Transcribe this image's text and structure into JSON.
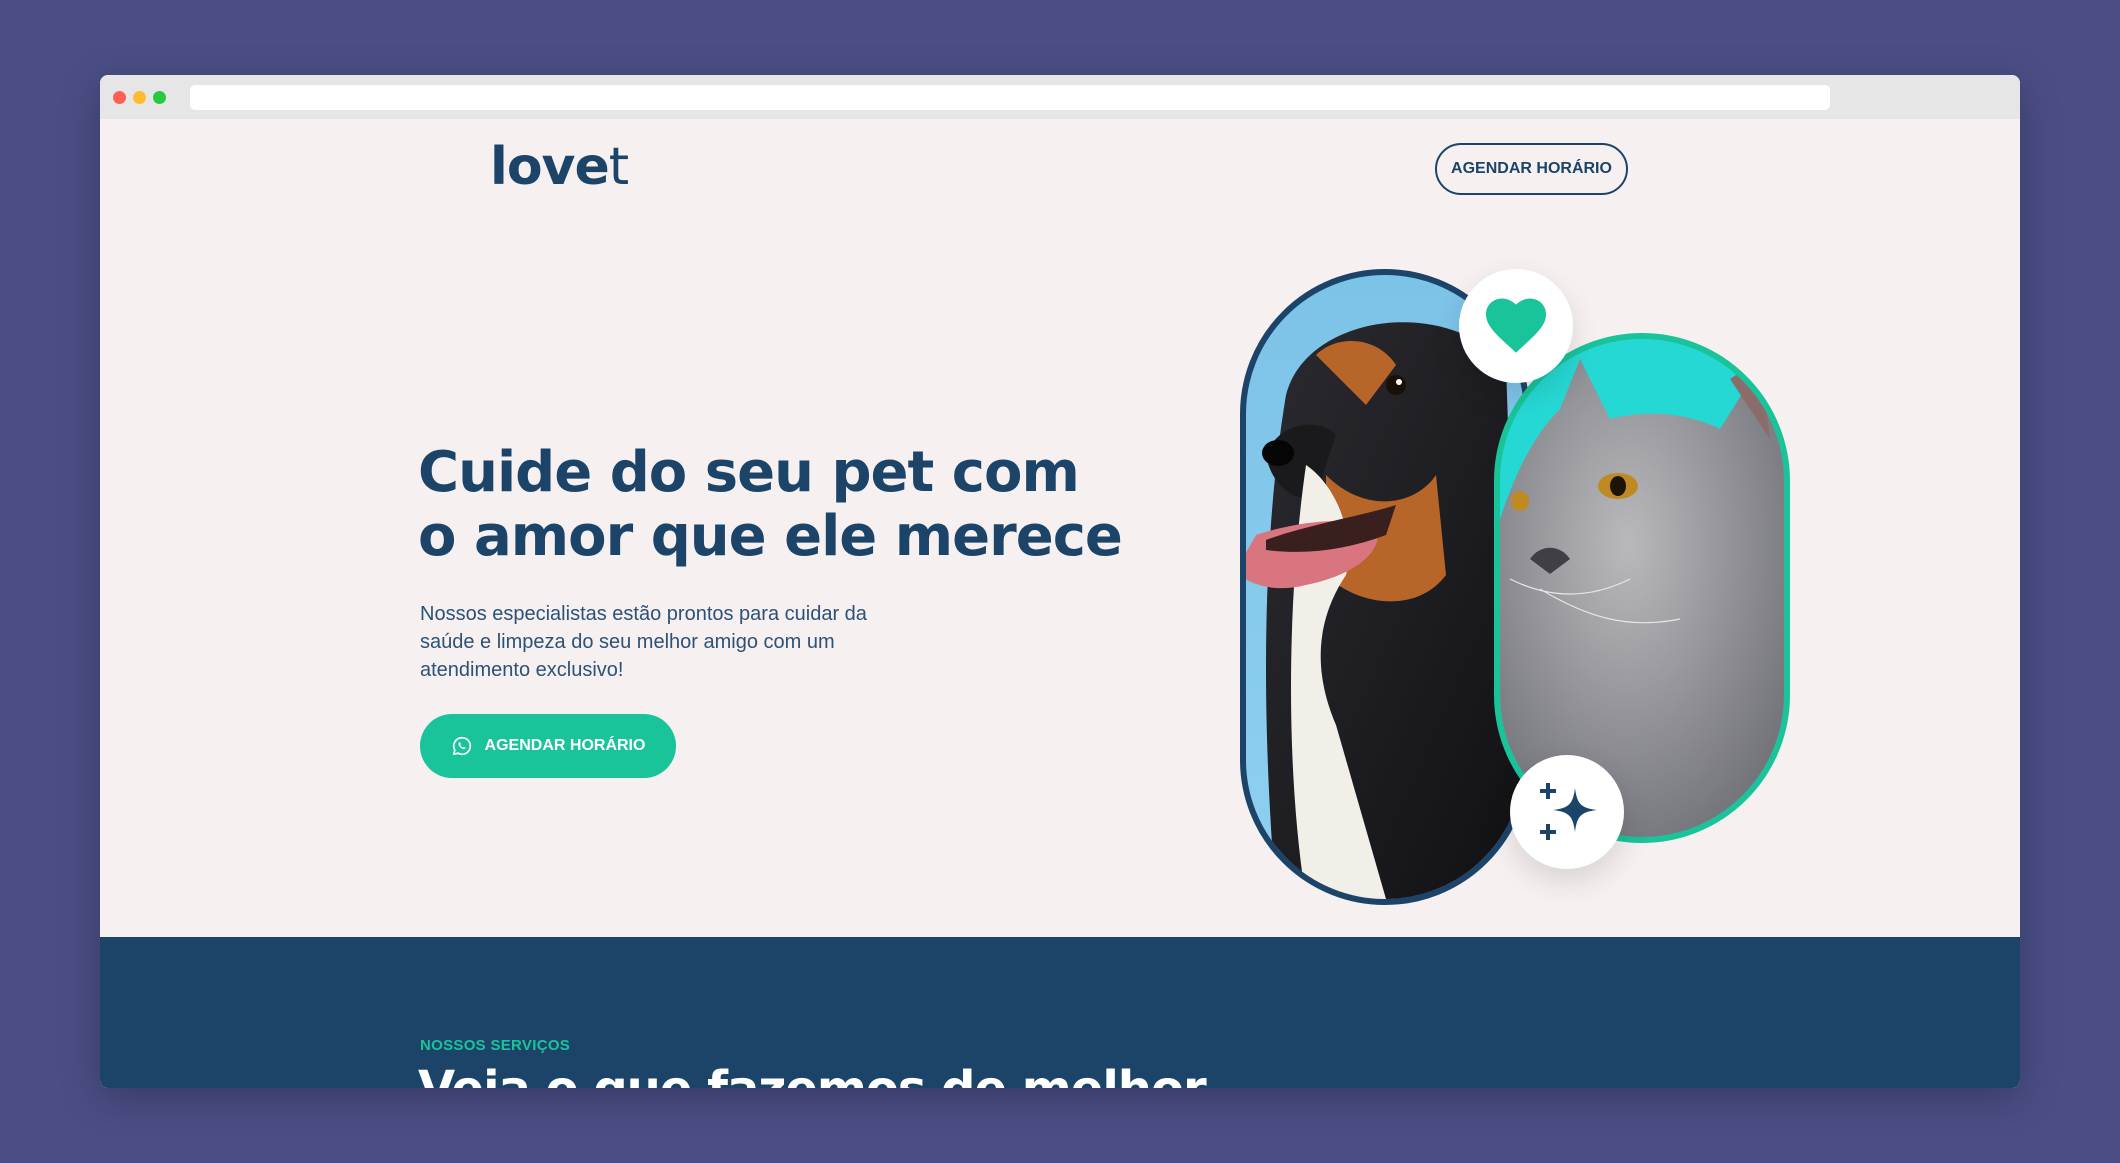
{
  "header": {
    "logo_bold": "love",
    "logo_thin": "t",
    "cta_label": "AGENDAR HORÁRIO"
  },
  "hero": {
    "title_line1": "Cuide do seu pet com",
    "title_line2": "o amor que ele merece",
    "description": "Nossos especialistas estão prontos para cuidar da saúde e limpeza do seu melhor amigo com um atendimento exclusivo!",
    "cta_label": "AGENDAR HORÁRIO",
    "cta_icon": "whatsapp-icon",
    "badges": [
      "heart-icon",
      "sparkle-icon"
    ]
  },
  "services": {
    "eyebrow": "NOSSOS SERVIÇOS",
    "title": "Veja o que fazemos de melhor"
  },
  "colors": {
    "primary": "#1c4469",
    "accent": "#19c49a",
    "background": "#f6f0f0",
    "outer": "#4a4e85"
  }
}
